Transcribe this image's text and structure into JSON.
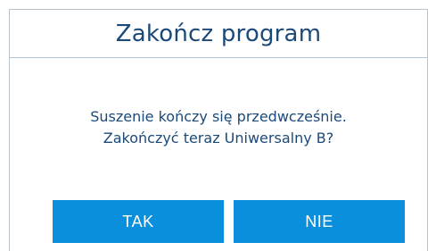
{
  "dialog": {
    "title": "Zakończ program",
    "message_line1": "Suszenie kończy się przedwcześnie.",
    "message_line2": "Zakończyć teraz Uniwersalny B?",
    "yes_label": "TAK",
    "no_label": "NIE"
  },
  "colors": {
    "accent": "#0a8fdc",
    "text": "#1b4a7a",
    "border": "#b9c3cb"
  }
}
